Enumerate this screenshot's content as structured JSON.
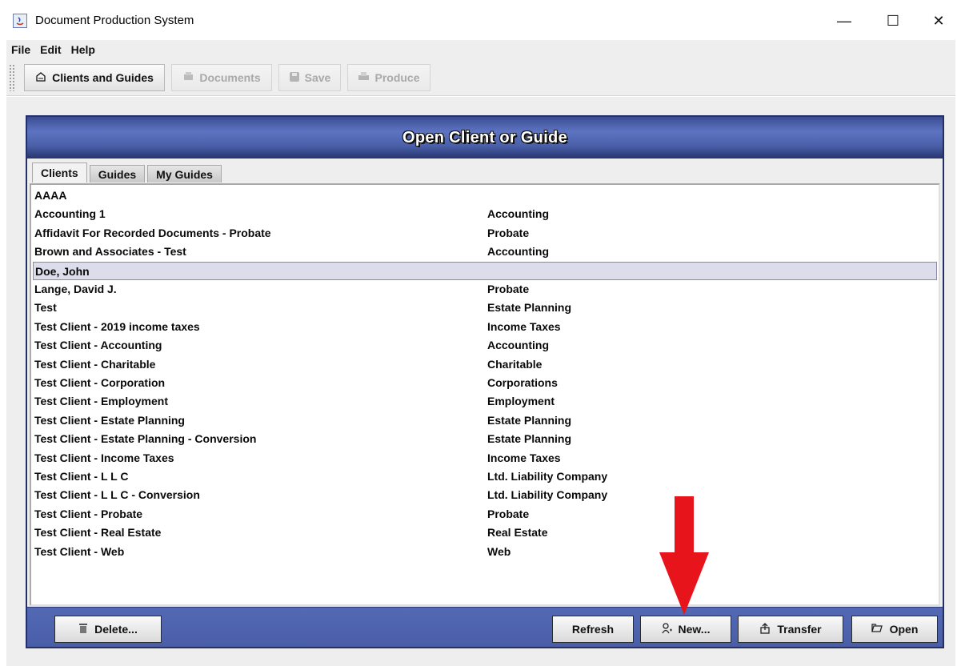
{
  "window": {
    "title": "Document Production System",
    "controls": {
      "minimize": "—",
      "maximize": "☐",
      "close": "✕"
    }
  },
  "menu": [
    "File",
    "Edit",
    "Help"
  ],
  "toolbar": {
    "clients_and_guides": "Clients and Guides",
    "documents": "Documents",
    "save": "Save",
    "produce": "Produce"
  },
  "dialog": {
    "title": "Open Client or Guide",
    "tabs": [
      "Clients",
      "Guides",
      "My Guides"
    ],
    "active_tab": "Clients"
  },
  "clients": [
    {
      "name": "AAAA",
      "category": ""
    },
    {
      "name": "Accounting 1",
      "category": "Accounting"
    },
    {
      "name": "Affidavit For Recorded Documents - Probate",
      "category": "Probate"
    },
    {
      "name": "Brown and Associates - Test",
      "category": "Accounting"
    },
    {
      "name": "Doe, John",
      "category": "",
      "selected": true
    },
    {
      "name": "Lange, David J.",
      "category": "Probate"
    },
    {
      "name": "Test",
      "category": "Estate Planning"
    },
    {
      "name": "Test Client - 2019 income taxes",
      "category": "Income Taxes"
    },
    {
      "name": "Test Client - Accounting",
      "category": "Accounting"
    },
    {
      "name": "Test Client - Charitable",
      "category": "Charitable"
    },
    {
      "name": "Test Client - Corporation",
      "category": "Corporations"
    },
    {
      "name": "Test Client - Employment",
      "category": "Employment"
    },
    {
      "name": "Test Client - Estate Planning",
      "category": "Estate Planning"
    },
    {
      "name": "Test Client - Estate Planning - Conversion",
      "category": "Estate Planning"
    },
    {
      "name": "Test Client - Income Taxes",
      "category": "Income Taxes"
    },
    {
      "name": "Test Client - L L C",
      "category": "Ltd. Liability Company"
    },
    {
      "name": "Test Client - L L C - Conversion",
      "category": "Ltd. Liability Company"
    },
    {
      "name": "Test Client - Probate",
      "category": "Probate"
    },
    {
      "name": "Test Client - Real Estate",
      "category": "Real Estate"
    },
    {
      "name": "Test Client - Web",
      "category": "Web"
    }
  ],
  "footer": {
    "delete": "Delete...",
    "refresh": "Refresh",
    "new": "New...",
    "transfer": "Transfer",
    "open": "Open"
  },
  "colors": {
    "header_blue": "#4a5fa8",
    "selection": "#dcdcea",
    "arrow_red": "#e8141c"
  }
}
